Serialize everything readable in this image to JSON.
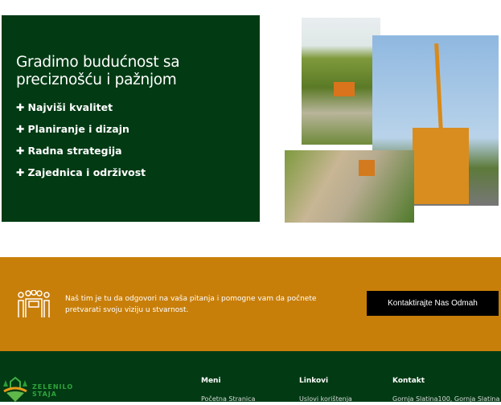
{
  "hero": {
    "title": "Gradimo budućnost sa preciznošću i pažnjom",
    "features": [
      "Najviši kvalitet",
      "Planiranje i dizajn",
      "Radna strategija",
      "Zajednica i održivost"
    ]
  },
  "cta": {
    "text": "Naš tim je tu da odgovori na vaša pitanja i pomogne vam da počnete pretvarati svoju viziju u stvarnost.",
    "button": "Kontaktirajte Nas Odmah"
  },
  "footer": {
    "logo_text": [
      "ZELENILO",
      "STAJA"
    ],
    "columns": [
      {
        "title": "Meni",
        "first": "Početna Stranica"
      },
      {
        "title": "Linkovi",
        "first": "Uslovi korištenja"
      },
      {
        "title": "Kontakt",
        "first": "Gornja Slatina100, Gornja Slatina"
      }
    ]
  },
  "colors": {
    "green": "#013a13",
    "orange": "#c87f0a"
  }
}
